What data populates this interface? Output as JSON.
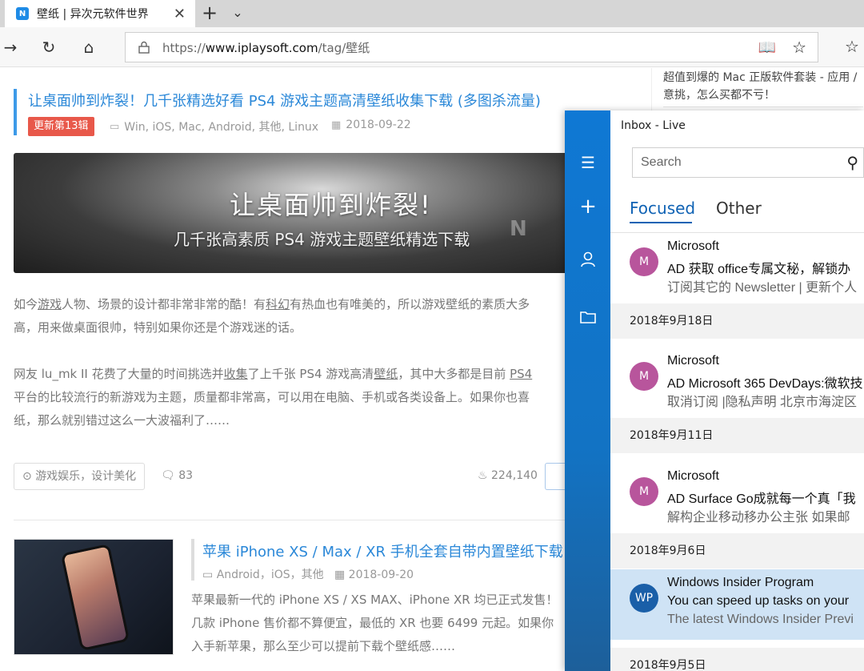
{
  "browser": {
    "tab_title": "壁纸 | 异次元软件世界",
    "tab_favicon": "N",
    "url_prefix": "https://",
    "url_host": "www.iplaysoft.com",
    "url_path": "/tag/壁纸"
  },
  "sidebar_note": {
    "line1": "超值到爆的 Mac 正版软件套装 - 应用 /",
    "line2": "意挑，怎么买都不亏！"
  },
  "article1": {
    "title": "让桌面帅到炸裂！几千张精选好看 PS4 游戏主题高清壁纸收集下载 (多图杀流量)",
    "badge": "更新第13辑",
    "platforms": "Win, iOS, Mac, Android, 其他, Linux",
    "date": "2018-09-22",
    "banner_line1": "让桌面帅到炸裂!",
    "banner_line2": "几千张高素质 PS4 游戏主题壁纸精选下载",
    "para1_a": "如今",
    "para1_link1": "游戏",
    "para1_b": "人物、场景的设计都非常非常的酷！有",
    "para1_link2": "科幻",
    "para1_c": "有热血也有唯美的，所以游戏壁纸的素质大多",
    "para1_d": "高，用来做桌面很帅，特别如果你还是个游戏迷的话。",
    "para2_a": "网友 lu_mk II 花费了大量的时间挑选并",
    "para2_link1": "收集",
    "para2_b": "了上千张 PS4 游戏高清",
    "para2_link2": "壁纸",
    "para2_c": "，其中大多都是目前 ",
    "para2_link3": "PS4",
    "para2_d": "平台的比较流行的新游戏为主题，质量都非常高，可以用在电脑、手机或各类设备上。如果你也喜",
    "para2_e": "纸，那么就别错过这么一大波福利了……",
    "tags": "游戏娱乐，设计美化",
    "comments": "83",
    "views": "224,140"
  },
  "article2": {
    "title": "苹果 iPhone XS / Max / XR 手机全套自带内置壁纸下载",
    "platforms": "Android，iOS，其他",
    "date": "2018-09-20",
    "line1": "苹果最新一代的 iPhone XS / XS MAX、iPhone XR 均已正式发售！",
    "line2": "几款 iPhone 售价都不算便宜，最低的 XR 也要 6499 元起。如果你",
    "line3": "入手新苹果，那么至少可以提前下载个壁纸感……"
  },
  "mail": {
    "title": "Inbox - Live",
    "search_placeholder": "Search",
    "tab_focused": "Focused",
    "tab_other": "Other",
    "items": [
      {
        "initials": "M",
        "from": "Microsoft",
        "subject": "AD 获取 office专属文秘，解锁办",
        "preview": "订阅其它的 Newsletter | 更新个人"
      },
      {
        "initials": "M",
        "from": "Microsoft",
        "subject": "AD Microsoft 365 DevDays:微软技",
        "preview": "取消订阅 |隐私声明 北京市海淀区"
      },
      {
        "initials": "M",
        "from": "Microsoft",
        "subject": "AD Surface Go成就每一个真「我",
        "preview": "解构企业移动移办公主张 如果邮"
      },
      {
        "initials": "WP",
        "from": "Windows Insider Program",
        "subject": "You can speed up tasks on your",
        "preview": "The latest Windows Insider Previ"
      }
    ],
    "dates": [
      "2018年9月18日",
      "2018年9月11日",
      "2018年9月6日",
      "2018年9月5日"
    ]
  },
  "colors": {
    "link_blue": "#2b88d8",
    "badge_red": "#e8584a",
    "mail_accent": "#0f62b4",
    "avatar_purple": "#b8559c",
    "avatar_blue": "#1a5fa8"
  }
}
